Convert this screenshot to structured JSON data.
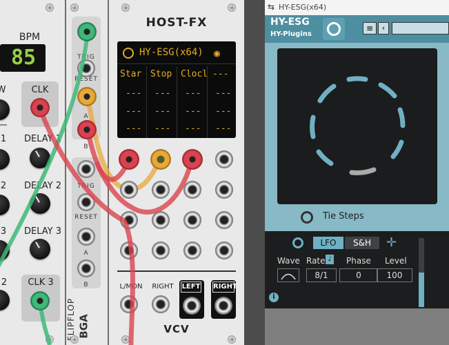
{
  "rack": {
    "delay_module": {
      "bpm_label": "BPM",
      "bpm_value": "85",
      "clk_label": "CLK",
      "delay_labels": [
        "DELAY 1",
        "DELAY 2",
        "DELAY 3"
      ],
      "clk3_label": "CLK 3",
      "left_numbers": [
        "1",
        "2",
        "3",
        "2"
      ],
      "w_label": "W"
    },
    "flipflop": {
      "trig1": "TRIG",
      "reset1": "RESET",
      "a1": "A",
      "b1": "B",
      "trig2": "TRIG",
      "reset2": "RESET",
      "a2": "A",
      "b2": "B",
      "name": "FLIPFLOP",
      "brand": "BGA"
    },
    "hostfx": {
      "title": "HOST-FX",
      "plugin_name": "HY-ESG(x64)",
      "columns": [
        "Star",
        "Stop",
        "Clocl",
        "---"
      ],
      "rows": [
        [
          "---",
          "---",
          "---",
          "---"
        ],
        [
          "---",
          "---",
          "---",
          "---"
        ],
        [
          "---",
          "---",
          "---",
          "---"
        ]
      ],
      "lmon": "L/MON",
      "right": "RIGHT",
      "left_btn": "LEFT",
      "right_btn": "RIGHT",
      "logo": "VCV"
    }
  },
  "plugin_window": {
    "title": "HY-ESG(x64)",
    "brand_top": "HY-ESG",
    "brand_bottom": "HY-Plugins",
    "tie_steps": "Tie Steps",
    "tabs": [
      "LFO",
      "S&H"
    ],
    "active_tab": "LFO",
    "params": {
      "wave_label": "Wave",
      "rate_label": "Rate",
      "phase_label": "Phase",
      "level_label": "Level",
      "rate_value": "8/1",
      "phase_value": "0",
      "level_value": "100"
    },
    "info": "i"
  },
  "colors": {
    "cable_red": "#d9434f",
    "cable_green": "#3fb879",
    "cable_orange": "#e8a83a",
    "plugin_bg": "#88b9c6",
    "screen_text": "#e3b020"
  }
}
